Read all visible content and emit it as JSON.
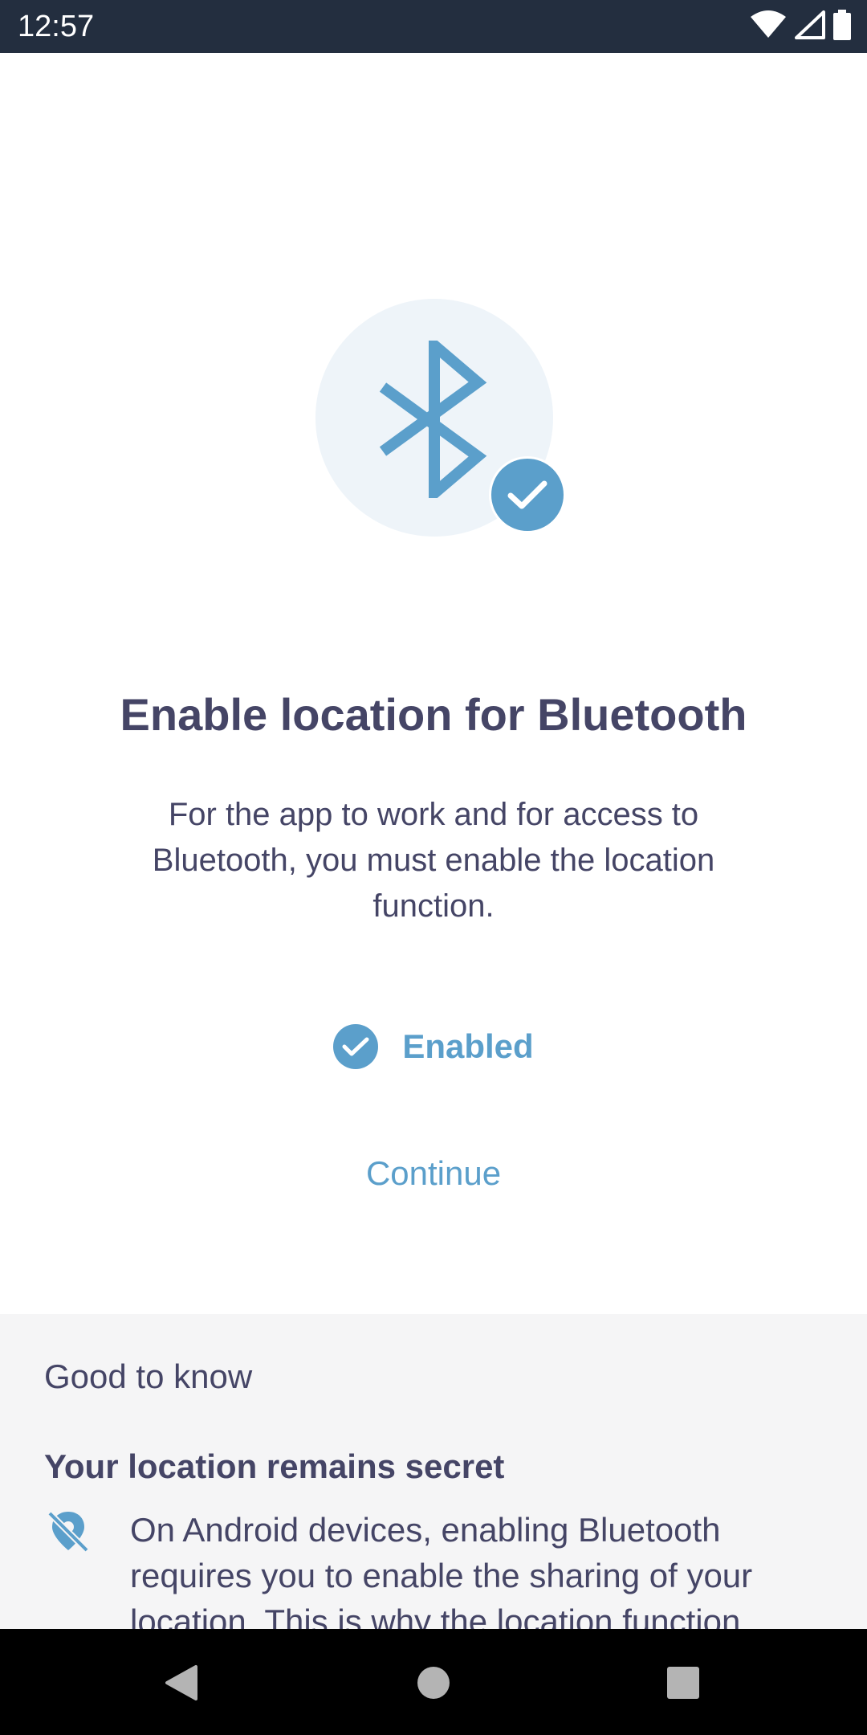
{
  "status_bar": {
    "time": "12:57",
    "icons": [
      "wifi-icon",
      "cell-signal-icon",
      "battery-icon"
    ]
  },
  "hero": {
    "icon": "bluetooth-icon",
    "badge_icon": "check-icon"
  },
  "main": {
    "title": "Enable location for Bluetooth",
    "description": "For the app to work and for access to Bluetooth, you must enable the location function.",
    "status_label": "Enabled",
    "continue_label": "Continue"
  },
  "info": {
    "heading": "Good to know",
    "subheading": "Your location remains secret",
    "icon": "location-off-icon",
    "text": "On Android devices, enabling Bluetooth requires you to enable the sharing of your location. This is why the location function"
  },
  "nav_bar": {
    "buttons": [
      "back-icon",
      "home-icon",
      "recents-icon"
    ]
  },
  "colors": {
    "accent": "#5b9fcb",
    "text": "#454566",
    "status_bar_bg": "#232e3f",
    "info_bg": "#f5f5f6",
    "hero_bg": "#eef4f9"
  }
}
